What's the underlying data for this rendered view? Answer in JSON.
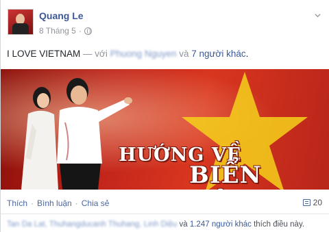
{
  "post": {
    "author": "Quang Le",
    "date": "8 Tháng 5",
    "privacy_icon": "globe-icon",
    "status_text": "I LOVE VIETNAM",
    "with_dash": " — với ",
    "tagged_person": "Phuong Nguyen",
    "and_word": " và ",
    "others_link": "7 người khác",
    "status_end": "."
  },
  "photo": {
    "title_line1": "HƯỚNG VỀ",
    "title_line2": "BIỂN ĐÔNG"
  },
  "actions": {
    "like": "Thích",
    "comment": "Bình luận",
    "share": "Chia sẻ",
    "comment_count": "20"
  },
  "likes": {
    "names": "Tan Da Lat, Thuhangducanh Thuhang, Linh Diệu",
    "and_word": " và ",
    "others_link": "1.247 người khác",
    "suffix": " thích điều này."
  },
  "colors": {
    "link": "#3b5998",
    "flag_red": "#d9361f",
    "star_yellow": "#f5d11b"
  }
}
